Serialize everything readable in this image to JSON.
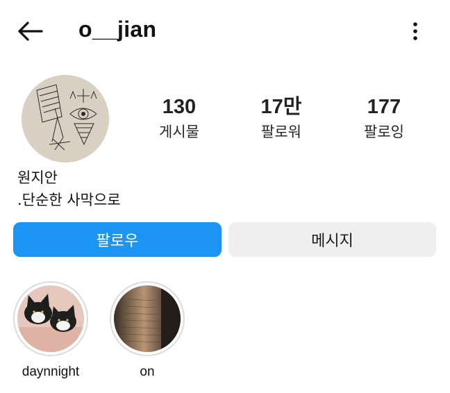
{
  "header": {
    "username": "o__jian",
    "back_icon": "arrow-left-icon",
    "more_icon": "more-vertical-icon"
  },
  "profile": {
    "stats": [
      {
        "value": "130",
        "label": "게시물"
      },
      {
        "value": "17만",
        "label": "팔로워"
      },
      {
        "value": "177",
        "label": "팔로잉"
      }
    ],
    "full_name": "원지안",
    "bio": ".단순한 사막으로"
  },
  "actions": {
    "follow_label": "팔로우",
    "message_label": "메시지",
    "follow_color": "#1a95f3",
    "message_bg": "#efefef"
  },
  "highlights": [
    {
      "label": "daynnight"
    },
    {
      "label": "on"
    }
  ]
}
